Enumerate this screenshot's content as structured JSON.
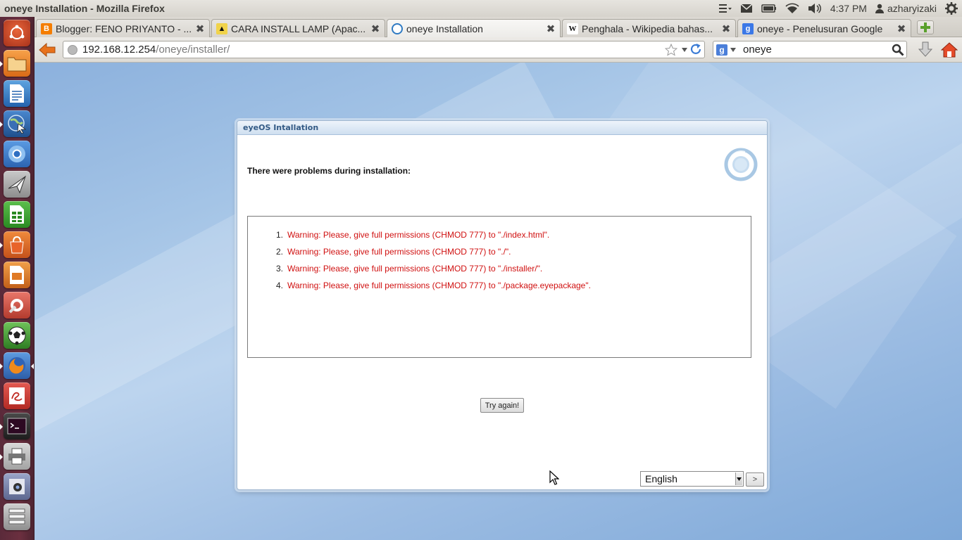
{
  "window": {
    "title": "oneye Installation - Mozilla Firefox"
  },
  "panel": {
    "time": "4:37 PM",
    "user": "azharyizaki"
  },
  "tabs": [
    {
      "label": "Blogger: FENO PRIYANTO - ...",
      "favicon": "blogger-icon",
      "active": false
    },
    {
      "label": "CARA INSTALL LAMP (Apac...",
      "favicon": "tux-icon",
      "active": false
    },
    {
      "label": "oneye Installation",
      "favicon": "eyeos-icon",
      "active": true
    },
    {
      "label": "Penghala - Wikipedia bahas...",
      "favicon": "wikipedia-icon",
      "active": false
    },
    {
      "label": "oneye - Penelusuran Google",
      "favicon": "google-icon",
      "active": false
    }
  ],
  "navbar": {
    "url_host": "192.168.12.254",
    "url_path": "/oneye/installer/",
    "search_value": "oneye"
  },
  "dialog": {
    "title": "eyeOS Intallation",
    "heading": "There were problems during installation:",
    "warnings": [
      {
        "num": "1.",
        "text": "Warning: Please, give full permissions (CHMOD 777) to \"./index.html\"."
      },
      {
        "num": "2.",
        "text": "Warning: Please, give full permissions (CHMOD 777) to \"./\"."
      },
      {
        "num": "3.",
        "text": "Warning: Please, give full permissions (CHMOD 777) to \"./installer/\"."
      },
      {
        "num": "4.",
        "text": "Warning: Please, give full permissions (CHMOD 777) to \"./package.eyepackage\"."
      }
    ],
    "try_again_label": "Try again!",
    "language_value": "English",
    "language_go_label": ">"
  },
  "colors": {
    "warning_text": "#d01010",
    "launcher_bg": "#6b2f3f",
    "dialog_title": "#335a85"
  }
}
